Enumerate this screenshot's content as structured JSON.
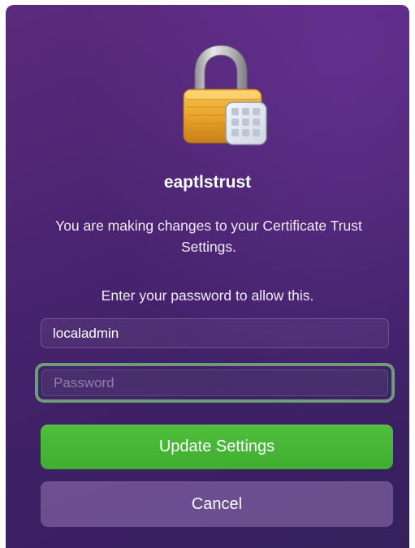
{
  "dialog": {
    "title": "eaptlstrust",
    "message": "You are making changes to your Certificate Trust Settings.",
    "prompt": "Enter your password to allow this.",
    "username": {
      "value": "localadmin"
    },
    "password": {
      "placeholder": "Password",
      "value": ""
    },
    "buttons": {
      "primary": "Update Settings",
      "secondary": "Cancel"
    },
    "icon": "lock-certificate-icon"
  },
  "colors": {
    "background_top": "#5b2a7e",
    "background_bottom": "#35205d",
    "primary_button": "#45b536",
    "focus_ring": "#6e9b78",
    "secondary_button": "#7d5fa0"
  }
}
